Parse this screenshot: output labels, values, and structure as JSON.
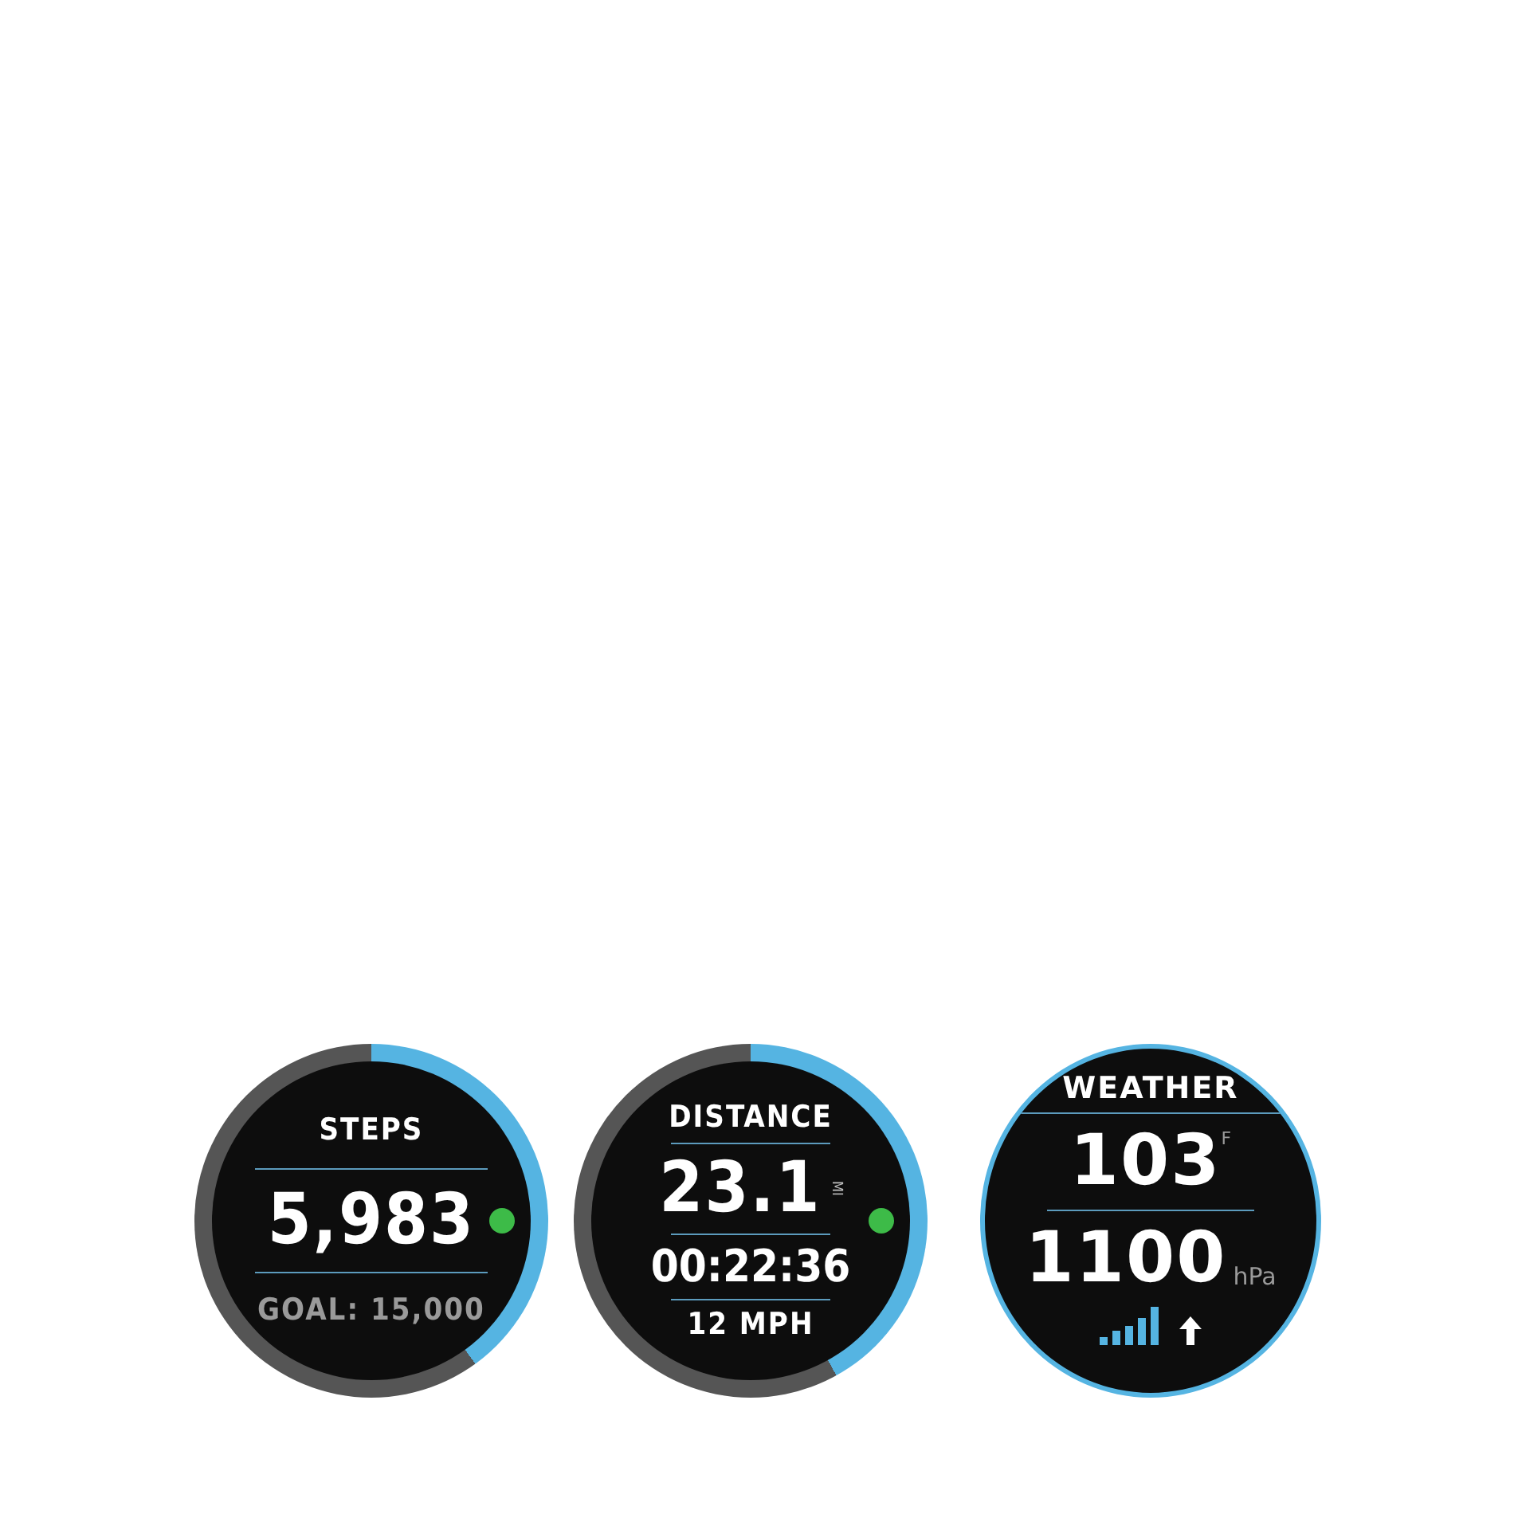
{
  "faces": [
    {
      "kind": "steps",
      "title": "STEPS",
      "value": "5,983",
      "color": "#3dbb48",
      "footer": "GOAL: 15,000"
    },
    {
      "kind": "distance",
      "title": "DISTANCE",
      "value": "23.1",
      "unit": "MI",
      "color": "#3dbb48",
      "time": "00:22:36",
      "footer": "12 MPH"
    },
    {
      "kind": "weather",
      "title": "WEATHER",
      "temperature": "103",
      "temperature_unit": "F",
      "pressure": "1100",
      "pressure_unit": "hPa"
    }
  ]
}
